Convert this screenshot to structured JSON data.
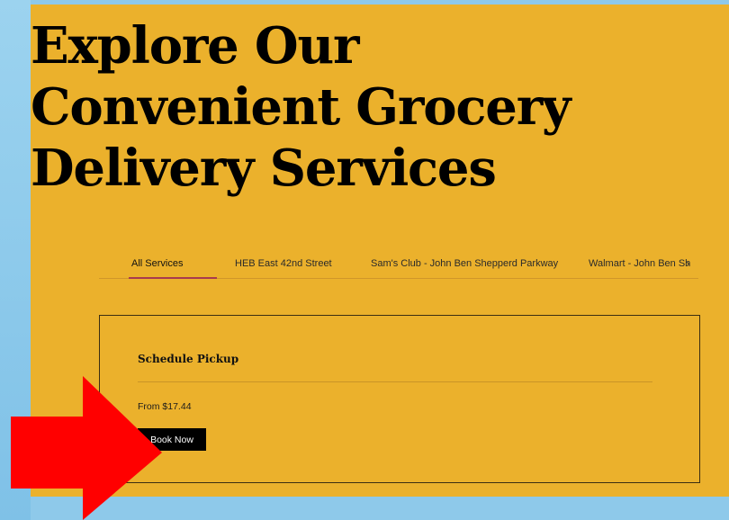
{
  "heading": {
    "line1": "Explore Our",
    "line2": "Convenient Grocery",
    "line3": "Delivery Services"
  },
  "tabs": [
    {
      "label": "All Services",
      "active": true
    },
    {
      "label": "HEB East 42nd Street",
      "active": false
    },
    {
      "label": "Sam's Club - John Ben Shepperd Parkway",
      "active": false
    },
    {
      "label": "Walmart - John Ben Sh",
      "active": false
    }
  ],
  "tabs_next_glyph": "›",
  "service_card": {
    "title": "Schedule Pickup",
    "price": "From $17.44",
    "button_label": "Book Now"
  },
  "colors": {
    "panel_background": "#ebb12c",
    "page_background": "#8ec9ea",
    "active_tab_underline": "#a73a4e",
    "arrow": "#ff0000",
    "button": "#000000"
  },
  "icons": [
    "chevron-right-icon",
    "red-arrow-annotation"
  ]
}
